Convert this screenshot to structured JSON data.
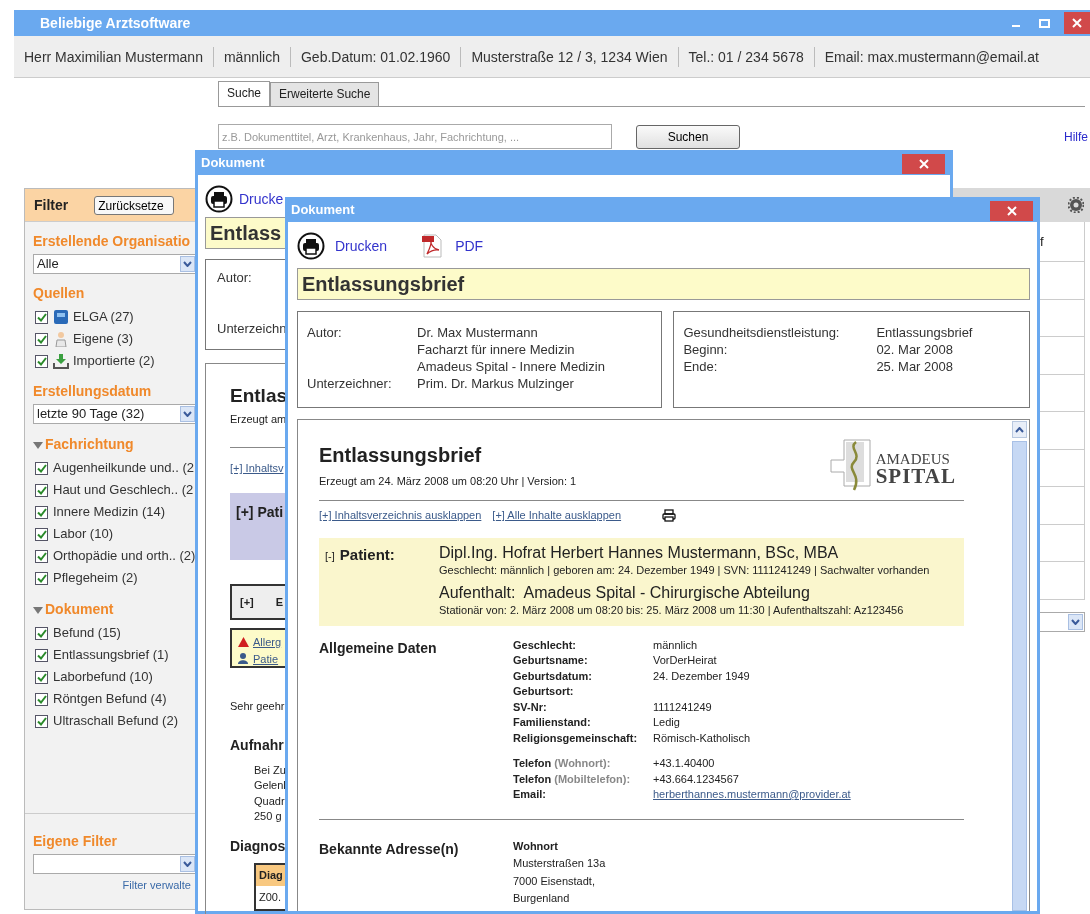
{
  "app": {
    "title": "Beliebige Arztsoftware"
  },
  "patient_bar": [
    "Herr Maximilian Mustermann",
    "männlich",
    "Geb.Datum: 01.02.1960",
    "Musterstraße 12 / 3, 1234 Wien",
    "Tel.: 01 / 234 5678",
    "Email: max.mustermann@email.at"
  ],
  "search_tabs": [
    {
      "label": "Suche",
      "selected": true
    },
    {
      "label": "Erweiterte Suche",
      "selected": false
    }
  ],
  "search": {
    "placeholder": "z.B. Dokumenttitel, Arzt, Krankenhaus, Jahr, Fachrichtung, ...",
    "button": "Suchen",
    "help": "Hilfe"
  },
  "filter": {
    "title": "Filter",
    "reset": "Zurücksetze",
    "organisation": {
      "label": "Erstellende Organisatio",
      "value": "Alle"
    },
    "sources": {
      "label": "Quellen",
      "items": [
        {
          "kind": "elga",
          "label": "ELGA (27)",
          "checked": true
        },
        {
          "kind": "own",
          "label": "Eigene (3)",
          "checked": true
        },
        {
          "kind": "import",
          "label": "Importierte (2)",
          "checked": true
        }
      ]
    },
    "date": {
      "label": "Erstellungsdatum",
      "value": "letzte 90 Tage (32)"
    },
    "groups": [
      {
        "label": "Fachrichtung",
        "expanded": true,
        "items": [
          {
            "label": "Augenheilkunde und.. (2",
            "checked": true
          },
          {
            "label": "Haut und Geschlech.. (2",
            "checked": true
          },
          {
            "label": "Innere Medizin (14)",
            "checked": true
          },
          {
            "label": "Labor (10)",
            "checked": true
          },
          {
            "label": "Orthopädie und orth.. (2)",
            "checked": true
          },
          {
            "label": "Pflegeheim (2)",
            "checked": true
          }
        ]
      },
      {
        "label": "Dokument",
        "expanded": true,
        "items": [
          {
            "label": "Befund (15)",
            "checked": true
          },
          {
            "label": "Entlassungsbrief (1)",
            "checked": true
          },
          {
            "label": "Laborbefund (10)",
            "checked": true
          },
          {
            "label": "Röntgen Befund (4)",
            "checked": true
          },
          {
            "label": "Ultraschall Befund (2)",
            "checked": true
          }
        ]
      }
    ],
    "own_filter": {
      "label": "Eigene Filter",
      "manage": "Filter verwalte"
    }
  },
  "results": {
    "column_1": "f"
  },
  "background_document": {
    "title": "Dokument",
    "print": "Drucke",
    "heading": "Entlass",
    "meta_labels": [
      "Autor:",
      "Unterzeichn"
    ],
    "body_heading": "Entlas",
    "created": "Erzeugt am",
    "toc_link": "[+] Inhaltsv",
    "patient": "[+] Pati",
    "section_toggle": "[+]",
    "section_title": "E",
    "alerts": [
      "Allerg",
      "Patie"
    ],
    "greeting": "Sehr geehr",
    "admission_heading": "Aufnahr",
    "admission_lines": [
      "Bei Zu",
      "Gelenl",
      "Quadr",
      "250 g"
    ],
    "diagnosis_heading": "Diagnos",
    "diagnosis_column": "Diag",
    "diagnosis_code": "Z00."
  },
  "document": {
    "title": "Dokument",
    "print": "Drucken",
    "pdf": "PDF",
    "heading": "Entlassungsbrief",
    "meta_left": [
      {
        "label": "Autor:",
        "values": [
          "Dr. Max Mustermann",
          "Facharzt für innere Medizin",
          "Amadeus Spital - Innere Medizin"
        ]
      },
      {
        "label": "Unterzeichner:",
        "values": [
          "Prim. Dr. Markus Mulzinger"
        ]
      }
    ],
    "meta_right": [
      {
        "label": "Gesundheitsdienstleistung:",
        "value": "Entlassungsbrief"
      },
      {
        "label": "Beginn:",
        "value": "02. Mar 2008"
      },
      {
        "label": "Ende:",
        "value": "25. Mar 2008"
      }
    ],
    "body": {
      "heading": "Entlassungsbrief",
      "created": "Erzeugt am 24. März 2008 um 08:20 Uhr | Version: 1",
      "logo": [
        "AMADEUS",
        "SPITAL"
      ],
      "links": [
        "[+] Inhaltsverzeichnis ausklappen",
        "[+] Alle Inhalte ausklappen"
      ],
      "patient": {
        "toggle": "[-]",
        "label": "Patient:",
        "name": "Dipl.Ing. Hofrat Herbert Hannes Mustermann, BSc, MBA",
        "details": "Geschlecht: männlich | geboren am: 24. Dezember 1949 | SVN: 1111241249 | Sachwalter vorhanden",
        "stay_label": "Aufenthalt:",
        "stay": "Amadeus Spital - Chirurgische Abteilung",
        "stay_details": "Stationär von: 2. März 2008 um 08:20 bis: 25. März 2008 um 11:30 | Aufenthaltszahl: Az123456"
      },
      "general": {
        "heading": "Allgemeine Daten",
        "groups": [
          [
            {
              "label": "Geschlecht:",
              "value": "männlich"
            },
            {
              "label": "Geburtsname:",
              "value": "VorDerHeirat"
            },
            {
              "label": "Geburtsdatum:",
              "value": "24. Dezember 1949"
            },
            {
              "label": "Geburtsort:"
            },
            {
              "label": "SV-Nr:",
              "value": "1111241249"
            },
            {
              "label": "Familienstand:",
              "value": "Ledig"
            },
            {
              "label": "Religionsgemeinschaft:",
              "value": "Römisch-Katholisch"
            }
          ],
          [
            {
              "label": "Telefon",
              "qualifier": "(Wohnort):",
              "value": "+43.1.40400"
            },
            {
              "label": "Telefon",
              "qualifier": "(Mobiltelefon):",
              "value": "+43.664.1234567"
            },
            {
              "label": "Email:",
              "value": "herberthannes.mustermann@provider.at",
              "kind": "link"
            }
          ]
        ]
      },
      "addresses": {
        "heading": "Bekannte Adresse(n)",
        "type": "Wohnort",
        "lines": [
          "Musterstraßen 13a",
          "7000 Eisenstadt,",
          "Burgenland"
        ]
      }
    }
  }
}
